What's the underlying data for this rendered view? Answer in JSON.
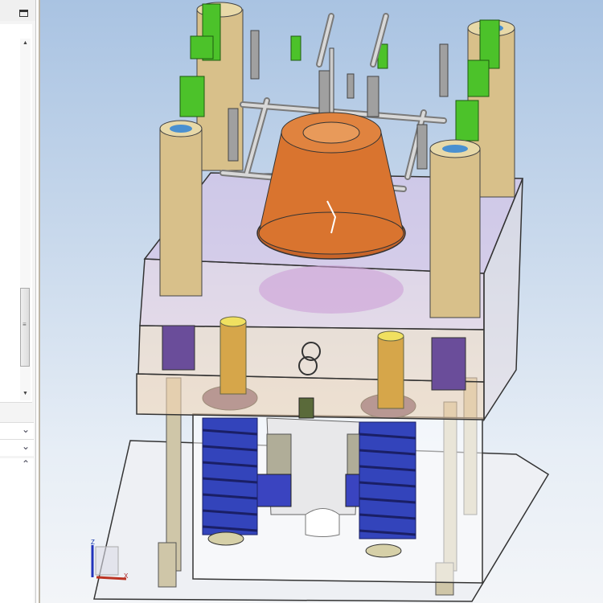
{
  "left_panel": {
    "sections": [
      {
        "icon": "chevron-down-icon",
        "glyph": "⌄"
      },
      {
        "icon": "chevron-down-icon",
        "glyph": "⌄"
      },
      {
        "icon": "chevron-up-icon",
        "glyph": "⌃"
      }
    ]
  },
  "viewport": {
    "triad": {
      "z_label": "Z",
      "x_label": "X"
    },
    "colors": {
      "background_top": "#a9c3e2",
      "pot": "#d9742f",
      "pillar": "#d8c08a",
      "spring": "#3344bb",
      "green_part": "#4cc22a",
      "rod": "#b8b8b8"
    }
  }
}
